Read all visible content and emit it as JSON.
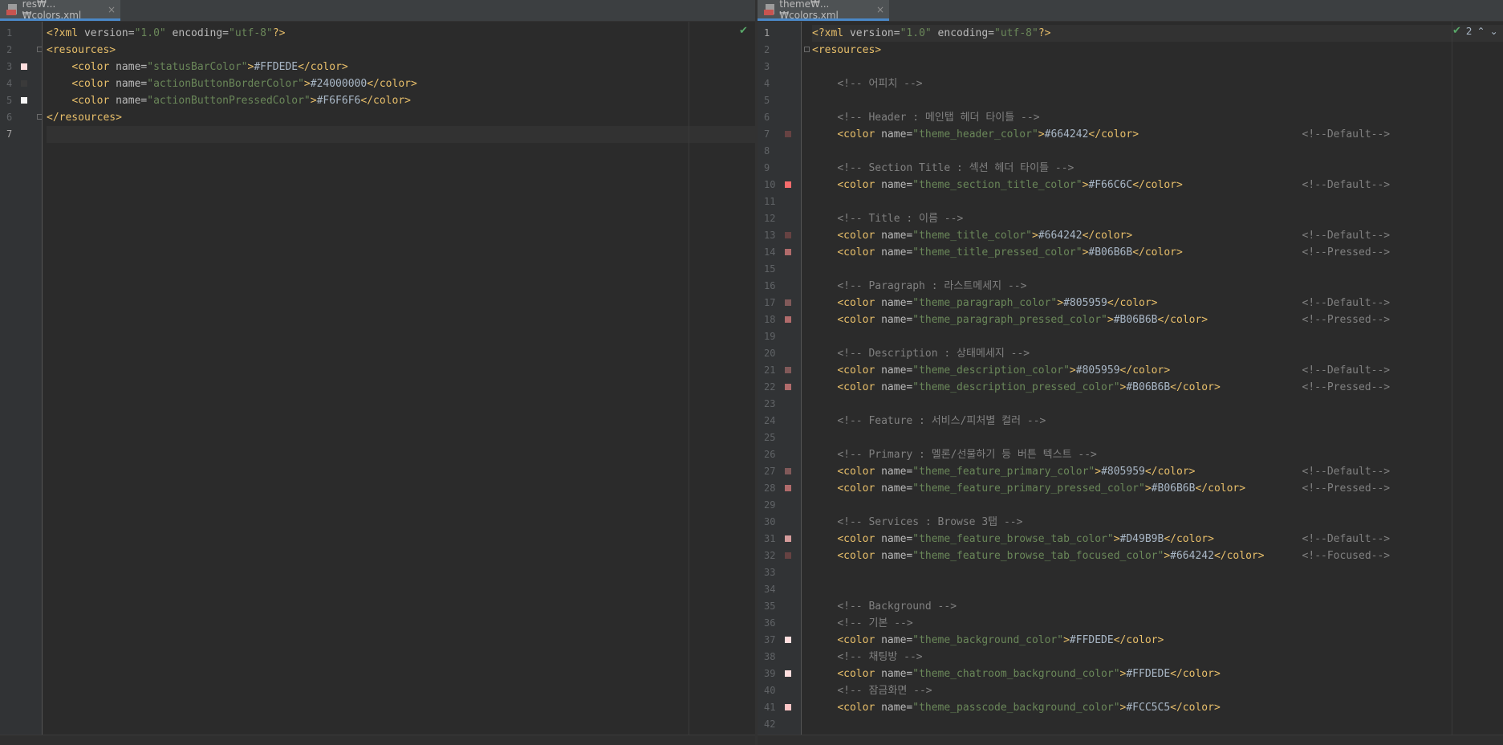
{
  "left_editor": {
    "tab_label": "res₩...₩colors.xml",
    "tab_close": "×",
    "inspection_icon": "checkmark-icon",
    "lines": [
      {
        "n": "1",
        "segs": [
          [
            "pi",
            "<?xml "
          ],
          [
            "attr",
            "version="
          ],
          [
            "val",
            "\"1.0\""
          ],
          [
            "attr",
            " encoding="
          ],
          [
            "val",
            "\"utf-8\""
          ],
          [
            "pi",
            "?>"
          ]
        ]
      },
      {
        "n": "2",
        "segs": [
          [
            "tag",
            "<resources>"
          ]
        ]
      },
      {
        "n": "3",
        "segs": [
          [
            "text",
            "    "
          ],
          [
            "tag",
            "<color "
          ],
          [
            "attr",
            "name="
          ],
          [
            "val",
            "\"statusBarColor\""
          ],
          [
            "tag",
            ">"
          ],
          [
            "text",
            "#FFDEDE"
          ],
          [
            "tag",
            "</color>"
          ]
        ]
      },
      {
        "n": "4",
        "segs": [
          [
            "text",
            "    "
          ],
          [
            "tag",
            "<color "
          ],
          [
            "attr",
            "name="
          ],
          [
            "val",
            "\"actionButtonBorderColor\""
          ],
          [
            "tag",
            ">"
          ],
          [
            "text",
            "#24000000"
          ],
          [
            "tag",
            "</color>"
          ]
        ]
      },
      {
        "n": "5",
        "segs": [
          [
            "text",
            "    "
          ],
          [
            "tag",
            "<color "
          ],
          [
            "attr",
            "name="
          ],
          [
            "val",
            "\"actionButtonPressedColor\""
          ],
          [
            "tag",
            ">"
          ],
          [
            "text",
            "#F6F6F6"
          ],
          [
            "tag",
            "</color>"
          ]
        ]
      },
      {
        "n": "6",
        "segs": [
          [
            "tag",
            "</resources>"
          ]
        ]
      },
      {
        "n": "7",
        "segs": []
      }
    ],
    "swatches": {
      "3": "#FFDEDE",
      "4": "#3a3a3a",
      "5": "#F6F6F6"
    },
    "current_line": "7"
  },
  "right_editor": {
    "tab_label": "theme₩...₩colors.xml",
    "tab_close": "×",
    "inspection_count": "2",
    "inspection_icon": "checkmark-icon",
    "lines": [
      {
        "n": "1",
        "segs": [
          [
            "pi",
            "<?xml "
          ],
          [
            "attr",
            "version="
          ],
          [
            "val",
            "\"1.0\""
          ],
          [
            "attr",
            " encoding="
          ],
          [
            "val",
            "\"utf-8\""
          ],
          [
            "pi",
            "?>"
          ]
        ]
      },
      {
        "n": "2",
        "segs": [
          [
            "tag",
            "<resources>"
          ]
        ]
      },
      {
        "n": "3",
        "segs": []
      },
      {
        "n": "4",
        "segs": [
          [
            "text",
            "    "
          ],
          [
            "cmt",
            "<!-- 어피치 -->"
          ]
        ]
      },
      {
        "n": "5",
        "segs": []
      },
      {
        "n": "6",
        "segs": [
          [
            "text",
            "    "
          ],
          [
            "cmt",
            "<!-- Header : 메인탭 헤더 타이틀 -->"
          ]
        ]
      },
      {
        "n": "7",
        "segs": [
          [
            "text",
            "    "
          ],
          [
            "tag",
            "<color "
          ],
          [
            "attr",
            "name="
          ],
          [
            "val",
            "\"theme_header_color\""
          ],
          [
            "tag",
            ">"
          ],
          [
            "text",
            "#664242"
          ],
          [
            "tag",
            "</color>"
          ],
          [
            "text",
            "                          "
          ],
          [
            "cmt",
            "<!--Default-->"
          ]
        ]
      },
      {
        "n": "8",
        "segs": []
      },
      {
        "n": "9",
        "segs": [
          [
            "text",
            "    "
          ],
          [
            "cmt",
            "<!-- Section Title : 섹션 헤더 타이틀 -->"
          ]
        ]
      },
      {
        "n": "10",
        "segs": [
          [
            "text",
            "    "
          ],
          [
            "tag",
            "<color "
          ],
          [
            "attr",
            "name="
          ],
          [
            "val",
            "\"theme_section_title_color\""
          ],
          [
            "tag",
            ">"
          ],
          [
            "text",
            "#F66C6C"
          ],
          [
            "tag",
            "</color>"
          ],
          [
            "text",
            "                   "
          ],
          [
            "cmt",
            "<!--Default-->"
          ]
        ]
      },
      {
        "n": "11",
        "segs": []
      },
      {
        "n": "12",
        "segs": [
          [
            "text",
            "    "
          ],
          [
            "cmt",
            "<!-- Title : 이름 -->"
          ]
        ]
      },
      {
        "n": "13",
        "segs": [
          [
            "text",
            "    "
          ],
          [
            "tag",
            "<color "
          ],
          [
            "attr",
            "name="
          ],
          [
            "val",
            "\"theme_title_color\""
          ],
          [
            "tag",
            ">"
          ],
          [
            "text",
            "#664242"
          ],
          [
            "tag",
            "</color>"
          ],
          [
            "text",
            "                           "
          ],
          [
            "cmt",
            "<!--Default-->"
          ]
        ]
      },
      {
        "n": "14",
        "segs": [
          [
            "text",
            "    "
          ],
          [
            "tag",
            "<color "
          ],
          [
            "attr",
            "name="
          ],
          [
            "val",
            "\"theme_title_pressed_color\""
          ],
          [
            "tag",
            ">"
          ],
          [
            "text",
            "#B06B6B"
          ],
          [
            "tag",
            "</color>"
          ],
          [
            "text",
            "                   "
          ],
          [
            "cmt",
            "<!--Pressed-->"
          ]
        ]
      },
      {
        "n": "15",
        "segs": []
      },
      {
        "n": "16",
        "segs": [
          [
            "text",
            "    "
          ],
          [
            "cmt",
            "<!-- Paragraph : 라스트메세지 -->"
          ]
        ]
      },
      {
        "n": "17",
        "segs": [
          [
            "text",
            "    "
          ],
          [
            "tag",
            "<color "
          ],
          [
            "attr",
            "name="
          ],
          [
            "val",
            "\"theme_paragraph_color\""
          ],
          [
            "tag",
            ">"
          ],
          [
            "text",
            "#805959"
          ],
          [
            "tag",
            "</color>"
          ],
          [
            "text",
            "                       "
          ],
          [
            "cmt",
            "<!--Default-->"
          ]
        ]
      },
      {
        "n": "18",
        "segs": [
          [
            "text",
            "    "
          ],
          [
            "tag",
            "<color "
          ],
          [
            "attr",
            "name="
          ],
          [
            "val",
            "\"theme_paragraph_pressed_color\""
          ],
          [
            "tag",
            ">"
          ],
          [
            "text",
            "#B06B6B"
          ],
          [
            "tag",
            "</color>"
          ],
          [
            "text",
            "               "
          ],
          [
            "cmt",
            "<!--Pressed-->"
          ]
        ]
      },
      {
        "n": "19",
        "segs": []
      },
      {
        "n": "20",
        "segs": [
          [
            "text",
            "    "
          ],
          [
            "cmt",
            "<!-- Description : 상태메세지 -->"
          ]
        ]
      },
      {
        "n": "21",
        "segs": [
          [
            "text",
            "    "
          ],
          [
            "tag",
            "<color "
          ],
          [
            "attr",
            "name="
          ],
          [
            "val",
            "\"theme_description_color\""
          ],
          [
            "tag",
            ">"
          ],
          [
            "text",
            "#805959"
          ],
          [
            "tag",
            "</color>"
          ],
          [
            "text",
            "                     "
          ],
          [
            "cmt",
            "<!--Default-->"
          ]
        ]
      },
      {
        "n": "22",
        "segs": [
          [
            "text",
            "    "
          ],
          [
            "tag",
            "<color "
          ],
          [
            "attr",
            "name="
          ],
          [
            "val",
            "\"theme_description_pressed_color\""
          ],
          [
            "tag",
            ">"
          ],
          [
            "text",
            "#B06B6B"
          ],
          [
            "tag",
            "</color>"
          ],
          [
            "text",
            "             "
          ],
          [
            "cmt",
            "<!--Pressed-->"
          ]
        ]
      },
      {
        "n": "23",
        "segs": []
      },
      {
        "n": "24",
        "segs": [
          [
            "text",
            "    "
          ],
          [
            "cmt",
            "<!-- Feature : 서비스/피처별 컬러 -->"
          ]
        ]
      },
      {
        "n": "25",
        "segs": []
      },
      {
        "n": "26",
        "segs": [
          [
            "text",
            "    "
          ],
          [
            "cmt",
            "<!-- Primary : 멜론/선물하기 등 버튼 텍스트 -->"
          ]
        ]
      },
      {
        "n": "27",
        "segs": [
          [
            "text",
            "    "
          ],
          [
            "tag",
            "<color "
          ],
          [
            "attr",
            "name="
          ],
          [
            "val",
            "\"theme_feature_primary_color\""
          ],
          [
            "tag",
            ">"
          ],
          [
            "text",
            "#805959"
          ],
          [
            "tag",
            "</color>"
          ],
          [
            "text",
            "                 "
          ],
          [
            "cmt",
            "<!--Default-->"
          ]
        ]
      },
      {
        "n": "28",
        "segs": [
          [
            "text",
            "    "
          ],
          [
            "tag",
            "<color "
          ],
          [
            "attr",
            "name="
          ],
          [
            "val",
            "\"theme_feature_primary_pressed_color\""
          ],
          [
            "tag",
            ">"
          ],
          [
            "text",
            "#B06B6B"
          ],
          [
            "tag",
            "</color>"
          ],
          [
            "text",
            "         "
          ],
          [
            "cmt",
            "<!--Pressed-->"
          ]
        ]
      },
      {
        "n": "29",
        "segs": []
      },
      {
        "n": "30",
        "segs": [
          [
            "text",
            "    "
          ],
          [
            "cmt",
            "<!-- Services : Browse 3탭 -->"
          ]
        ]
      },
      {
        "n": "31",
        "segs": [
          [
            "text",
            "    "
          ],
          [
            "tag",
            "<color "
          ],
          [
            "attr",
            "name="
          ],
          [
            "val",
            "\"theme_feature_browse_tab_color\""
          ],
          [
            "tag",
            ">"
          ],
          [
            "text",
            "#D49B9B"
          ],
          [
            "tag",
            "</color>"
          ],
          [
            "text",
            "              "
          ],
          [
            "cmt",
            "<!--Default-->"
          ]
        ]
      },
      {
        "n": "32",
        "segs": [
          [
            "text",
            "    "
          ],
          [
            "tag",
            "<color "
          ],
          [
            "attr",
            "name="
          ],
          [
            "val",
            "\"theme_feature_browse_tab_focused_color\""
          ],
          [
            "tag",
            ">"
          ],
          [
            "text",
            "#664242"
          ],
          [
            "tag",
            "</color>"
          ],
          [
            "text",
            "      "
          ],
          [
            "cmt",
            "<!--Focused-->"
          ]
        ]
      },
      {
        "n": "33",
        "segs": []
      },
      {
        "n": "34",
        "segs": []
      },
      {
        "n": "35",
        "segs": [
          [
            "text",
            "    "
          ],
          [
            "cmt",
            "<!-- Background -->"
          ]
        ]
      },
      {
        "n": "36",
        "segs": [
          [
            "text",
            "    "
          ],
          [
            "cmt",
            "<!-- 기본 -->"
          ]
        ]
      },
      {
        "n": "37",
        "segs": [
          [
            "text",
            "    "
          ],
          [
            "tag",
            "<color "
          ],
          [
            "attr",
            "name="
          ],
          [
            "val",
            "\"theme_background_color\""
          ],
          [
            "tag",
            ">"
          ],
          [
            "text",
            "#FFDEDE"
          ],
          [
            "tag",
            "</color>"
          ]
        ]
      },
      {
        "n": "38",
        "segs": [
          [
            "text",
            "    "
          ],
          [
            "cmt",
            "<!-- 채팅방 -->"
          ]
        ]
      },
      {
        "n": "39",
        "segs": [
          [
            "text",
            "    "
          ],
          [
            "tag",
            "<color "
          ],
          [
            "attr",
            "name="
          ],
          [
            "val",
            "\"theme_chatroom_background_color\""
          ],
          [
            "tag",
            ">"
          ],
          [
            "text",
            "#FFDEDE"
          ],
          [
            "tag",
            "</color>"
          ]
        ]
      },
      {
        "n": "40",
        "segs": [
          [
            "text",
            "    "
          ],
          [
            "cmt",
            "<!-- 잠금화면 -->"
          ]
        ]
      },
      {
        "n": "41",
        "segs": [
          [
            "text",
            "    "
          ],
          [
            "tag",
            "<color "
          ],
          [
            "attr",
            "name="
          ],
          [
            "val",
            "\"theme_passcode_background_color\""
          ],
          [
            "tag",
            ">"
          ],
          [
            "text",
            "#FCC5C5"
          ],
          [
            "tag",
            "</color>"
          ]
        ]
      },
      {
        "n": "42",
        "segs": []
      }
    ],
    "swatches": {
      "7": "#664242",
      "10": "#F66C6C",
      "13": "#664242",
      "14": "#B06B6B",
      "17": "#805959",
      "18": "#B06B6B",
      "21": "#805959",
      "22": "#B06B6B",
      "27": "#805959",
      "28": "#B06B6B",
      "31": "#D49B9B",
      "32": "#664242",
      "37": "#FFDEDE",
      "39": "#FFDEDE",
      "41": "#FCC5C5"
    },
    "current_line": "1"
  },
  "colors": {
    "editor_bg": "#2b2b2b",
    "tag": "#e8bf6a",
    "attr_value": "#6a8759",
    "comment": "#808080",
    "inspection_ok": "#59a869"
  }
}
